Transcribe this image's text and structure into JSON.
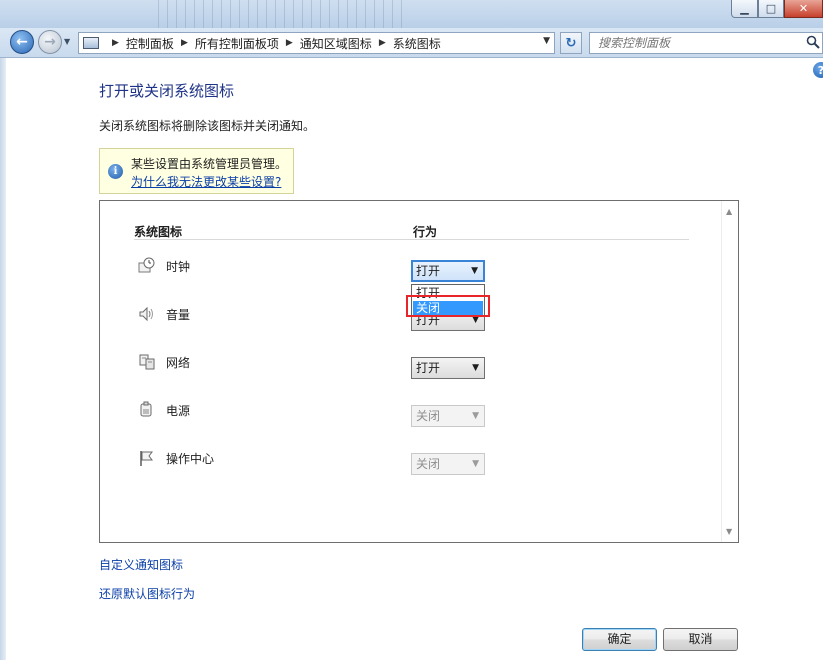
{
  "breadcrumb": [
    "控制面板",
    "所有控制面板项",
    "通知区域图标",
    "系统图标"
  ],
  "search": {
    "placeholder": "搜索控制面板"
  },
  "page": {
    "title": "打开或关闭系统图标",
    "description": "关闭系统图标将删除该图标并关闭通知。"
  },
  "info": {
    "text": "某些设置由系统管理员管理。",
    "link": "为什么我无法更改某些设置?"
  },
  "table": {
    "col_icon": "系统图标",
    "col_behavior": "行为",
    "rows": [
      {
        "label": "时钟",
        "icon": "clock-icon",
        "value": "打开",
        "enabled": true
      },
      {
        "label": "音量",
        "icon": "volume-icon",
        "value": "打开",
        "enabled": true
      },
      {
        "label": "网络",
        "icon": "network-icon",
        "value": "打开",
        "enabled": true
      },
      {
        "label": "电源",
        "icon": "power-icon",
        "value": "关闭",
        "enabled": false
      },
      {
        "label": "操作中心",
        "icon": "flag-icon",
        "value": "关闭",
        "enabled": false
      }
    ]
  },
  "dropdown": {
    "options": [
      "打开",
      "关闭"
    ],
    "highlighted": "关闭"
  },
  "links": {
    "customize": "自定义通知图标",
    "restore": "还原默认图标行为"
  },
  "buttons": {
    "ok": "确定",
    "cancel": "取消"
  },
  "colors": {
    "title": "#1e3287",
    "link": "#0b3fa8",
    "selection": "#3399ff",
    "highlight_frame": "#e8262a",
    "info_bg": "#ffffe1"
  }
}
